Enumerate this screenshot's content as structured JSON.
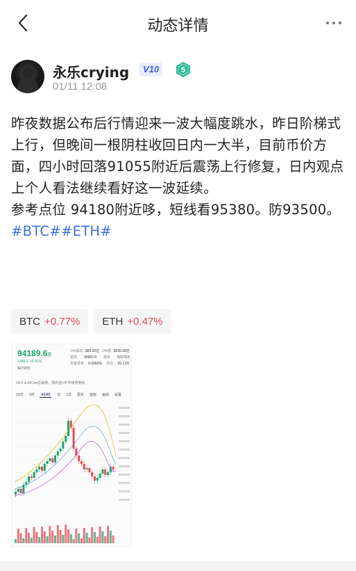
{
  "header": {
    "title": "动态详情"
  },
  "author": {
    "name": "永乐crying",
    "vip": "V10",
    "level": "5",
    "time": "01/11 12:08"
  },
  "post": {
    "paragraph1": "昨夜数据公布后行情迎来一波大幅度跳水，昨日阶梯式上行，但晚间一根阴柱收回日内一大半，目前币价方面，四小时回落91055附近后震荡上行修复，日内观点上个人看法继续看好这一波延续。",
    "paragraph2_text": "参考点位 94180附近哆，短线看95380。防93500。",
    "tag1": "#BTC#",
    "tag2": "#ETH#"
  },
  "tickers": [
    {
      "symbol": "BTC",
      "change": "+0.77%"
    },
    {
      "symbol": "ETH",
      "change": "+0.47%"
    }
  ],
  "chart_image": {
    "price": "94189.6",
    "price_unit": "万",
    "change_abs": "+386.2",
    "change_pct": "+0.41%",
    "volume_label": "$6758万",
    "stats": [
      {
        "label": "24h最高",
        "value": "$82.92亿"
      },
      {
        "label": "24h额",
        "value": "$236.58亿"
      },
      {
        "label": "最高",
        "value": "95882.5"
      },
      {
        "label": "最低",
        "value": "92173.6"
      },
      {
        "label": "资金费率",
        "value": "0.0063%"
      },
      {
        "label": "持仓",
        "value": "25.13万"
      }
    ],
    "notice": "OKX & AICoin达最新，限时送VIP手续费等级",
    "tabs": [
      "15分",
      "1时",
      "4小时",
      "日",
      "1日",
      "更多",
      "指标",
      "画线",
      "设置"
    ],
    "active_tab": "4小时",
    "colors": {
      "up": "#1aa56b",
      "down": "#e8485a",
      "ma": "#e7b300"
    }
  },
  "colors": {
    "accent": "#3e6fd9",
    "positive": "#e8485a",
    "vip": "#3d5bd6",
    "level": "#2bb896"
  }
}
